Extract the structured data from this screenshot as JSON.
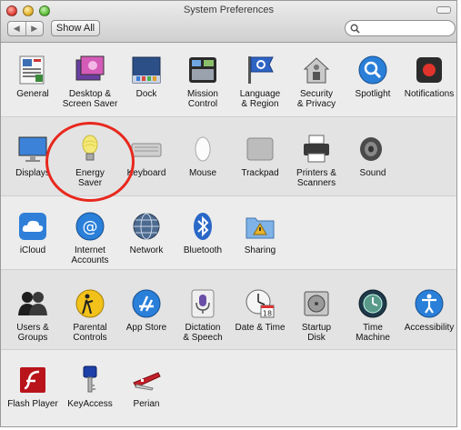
{
  "window": {
    "title": "System Preferences"
  },
  "toolbar": {
    "back_glyph": "◀",
    "forward_glyph": "▶",
    "show_all_label": "Show All",
    "search_value": "",
    "search_placeholder": ""
  },
  "rows": {
    "personal": [
      {
        "label": "General",
        "icon": "general-icon"
      },
      {
        "label": "Desktop &\nScreen Saver",
        "icon": "desktop-icon"
      },
      {
        "label": "Dock",
        "icon": "dock-icon"
      },
      {
        "label": "Mission\nControl",
        "icon": "mission-control-icon"
      },
      {
        "label": "Language\n& Region",
        "icon": "language-region-icon"
      },
      {
        "label": "Security\n& Privacy",
        "icon": "security-privacy-icon"
      },
      {
        "label": "Spotlight",
        "icon": "spotlight-icon"
      },
      {
        "label": "Notifications",
        "icon": "notifications-icon"
      }
    ],
    "hardware": [
      {
        "label": "Displays",
        "icon": "displays-icon"
      },
      {
        "label": "Energy\nSaver",
        "icon": "energy-saver-icon"
      },
      {
        "label": "Keyboard",
        "icon": "keyboard-icon"
      },
      {
        "label": "Mouse",
        "icon": "mouse-icon"
      },
      {
        "label": "Trackpad",
        "icon": "trackpad-icon"
      },
      {
        "label": "Printers &\nScanners",
        "icon": "printers-scanners-icon"
      },
      {
        "label": "Sound",
        "icon": "sound-icon"
      }
    ],
    "internet": [
      {
        "label": "iCloud",
        "icon": "icloud-icon"
      },
      {
        "label": "Internet\nAccounts",
        "icon": "internet-accounts-icon"
      },
      {
        "label": "Network",
        "icon": "network-icon"
      },
      {
        "label": "Bluetooth",
        "icon": "bluetooth-icon"
      },
      {
        "label": "Sharing",
        "icon": "sharing-icon"
      }
    ],
    "system": [
      {
        "label": "Users &\nGroups",
        "icon": "users-groups-icon"
      },
      {
        "label": "Parental\nControls",
        "icon": "parental-controls-icon"
      },
      {
        "label": "App Store",
        "icon": "app-store-icon"
      },
      {
        "label": "Dictation\n& Speech",
        "icon": "dictation-speech-icon"
      },
      {
        "label": "Date & Time",
        "icon": "date-time-icon"
      },
      {
        "label": "Startup\nDisk",
        "icon": "startup-disk-icon"
      },
      {
        "label": "Time\nMachine",
        "icon": "time-machine-icon"
      },
      {
        "label": "Accessibility",
        "icon": "accessibility-icon"
      }
    ],
    "other": [
      {
        "label": "Flash Player",
        "icon": "flash-player-icon"
      },
      {
        "label": "KeyAccess",
        "icon": "keyaccess-icon"
      },
      {
        "label": "Perian",
        "icon": "perian-icon"
      }
    ]
  },
  "highlight": {
    "target": "Energy Saver",
    "color": "#e8281e"
  },
  "colors": {
    "accent_blue": "#2a7fd9",
    "highlight_red": "#e8281e"
  }
}
